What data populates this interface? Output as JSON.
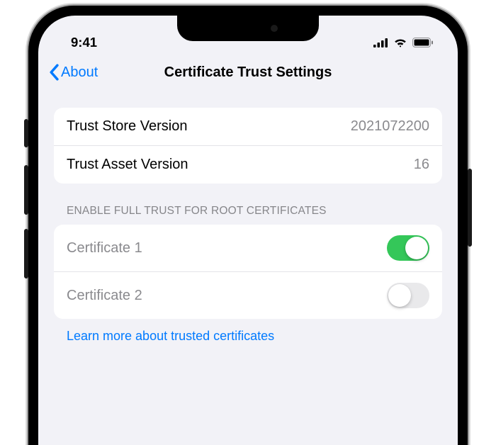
{
  "status": {
    "time": "9:41"
  },
  "nav": {
    "back_label": "About",
    "title": "Certificate Trust Settings"
  },
  "info_rows": [
    {
      "label": "Trust Store Version",
      "value": "2021072200"
    },
    {
      "label": "Trust Asset Version",
      "value": "16"
    }
  ],
  "section_header": "ENABLE FULL TRUST FOR ROOT CERTIFICATES",
  "cert_rows": [
    {
      "label": "Certificate 1",
      "enabled": true
    },
    {
      "label": "Certificate 2",
      "enabled": false
    }
  ],
  "footer_link": "Learn more about trusted certificates"
}
